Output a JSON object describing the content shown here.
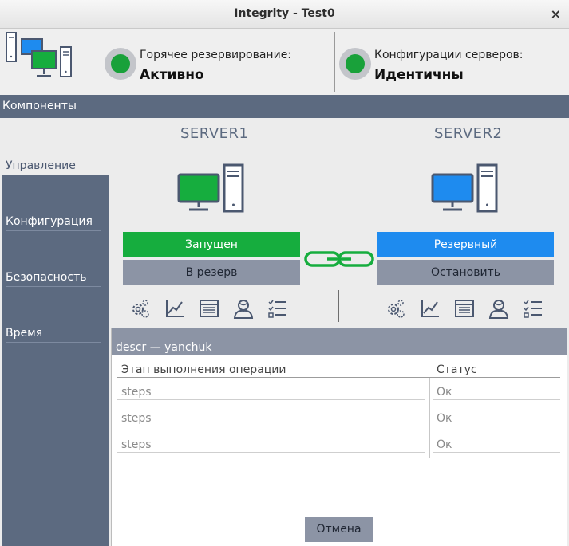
{
  "window": {
    "title": "Integrity - Test0",
    "close_symbol": "×"
  },
  "header": {
    "hot_standby": {
      "label": "Горячее резервирование:",
      "value": "Активно",
      "color": "#19a13a"
    },
    "config": {
      "label": "Конфигурации серверов:",
      "value": "Идентичны",
      "color": "#19a13a"
    }
  },
  "section": {
    "title": "Компоненты"
  },
  "sidebar": {
    "items": [
      {
        "label": "Управление",
        "active": true
      },
      {
        "label": "Конфигурация"
      },
      {
        "label": "Безопасность"
      },
      {
        "label": "Время"
      }
    ]
  },
  "servers": [
    {
      "name": "SERVER1",
      "screen_color": "#16ad3e",
      "state_label": "Запущен",
      "state_color": "#16ad3e",
      "action_label": "В резерв"
    },
    {
      "name": "SERVER2",
      "screen_color": "#1e8bef",
      "state_label": "Резервный",
      "state_color": "#1e8bef",
      "action_label": "Остановить"
    }
  ],
  "link_icon": "chain-link-icon",
  "toolbar_icons": [
    "settings-icon",
    "chart-icon",
    "log-icon",
    "user-icon",
    "list-icon"
  ],
  "operation_panel": {
    "title": "descr — yanchuk",
    "columns": [
      "Этап выполнения операции",
      "Статус"
    ],
    "rows": [
      {
        "step": "steps",
        "status": "Ок"
      },
      {
        "step": "steps",
        "status": "Ок"
      },
      {
        "step": "steps",
        "status": "Ок"
      }
    ],
    "cancel_label": "Отмена"
  },
  "colors": {
    "accent": "#5c6a80",
    "button_gray": "#8c94a5",
    "ok_green": "#19a13a",
    "standby_blue": "#1e8bef"
  }
}
